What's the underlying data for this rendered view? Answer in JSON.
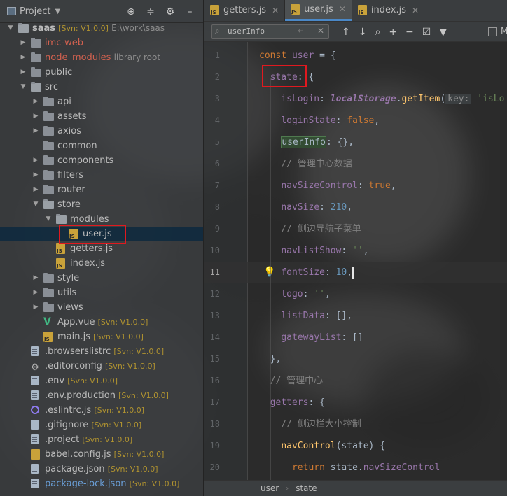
{
  "project": {
    "title": "Project",
    "tree": [
      {
        "label": "saas",
        "svn": "[Svn: V1.0.0]",
        "path": "E:\\work\\saas",
        "indent": 0,
        "kind": "folder-open",
        "arrow": "down",
        "style": "normal"
      },
      {
        "label": "imc-web",
        "indent": 1,
        "kind": "folder",
        "arrow": "right",
        "style": "red"
      },
      {
        "label": "node_modules",
        "lib": "library root",
        "indent": 1,
        "kind": "folder",
        "arrow": "right",
        "style": "red"
      },
      {
        "label": "public",
        "indent": 1,
        "kind": "folder",
        "arrow": "right",
        "style": "normal"
      },
      {
        "label": "src",
        "indent": 1,
        "kind": "folder-open",
        "arrow": "down",
        "style": "normal"
      },
      {
        "label": "api",
        "indent": 2,
        "kind": "folder",
        "arrow": "right",
        "style": "normal"
      },
      {
        "label": "assets",
        "indent": 2,
        "kind": "folder",
        "arrow": "right",
        "style": "normal"
      },
      {
        "label": "axios",
        "indent": 2,
        "kind": "folder",
        "arrow": "right",
        "style": "normal"
      },
      {
        "label": "common",
        "indent": 2,
        "kind": "folder",
        "arrow": "none",
        "style": "normal"
      },
      {
        "label": "components",
        "indent": 2,
        "kind": "folder",
        "arrow": "right",
        "style": "normal"
      },
      {
        "label": "filters",
        "indent": 2,
        "kind": "folder",
        "arrow": "right",
        "style": "normal"
      },
      {
        "label": "router",
        "indent": 2,
        "kind": "folder",
        "arrow": "right",
        "style": "normal"
      },
      {
        "label": "store",
        "indent": 2,
        "kind": "folder-open",
        "arrow": "down",
        "style": "normal"
      },
      {
        "label": "modules",
        "indent": 3,
        "kind": "folder-open",
        "arrow": "down",
        "style": "normal"
      },
      {
        "label": "user.js",
        "indent": 4,
        "kind": "js",
        "arrow": "none",
        "style": "normal",
        "selected": true
      },
      {
        "label": "getters.js",
        "indent": 3,
        "kind": "js",
        "arrow": "none",
        "style": "normal"
      },
      {
        "label": "index.js",
        "indent": 3,
        "kind": "js",
        "arrow": "none",
        "style": "normal"
      },
      {
        "label": "style",
        "indent": 2,
        "kind": "folder",
        "arrow": "right",
        "style": "normal"
      },
      {
        "label": "utils",
        "indent": 2,
        "kind": "folder",
        "arrow": "right",
        "style": "normal"
      },
      {
        "label": "views",
        "indent": 2,
        "kind": "folder",
        "arrow": "right",
        "style": "normal"
      },
      {
        "label": "App.vue",
        "svn": "[Svn: V1.0.0]",
        "indent": 2,
        "kind": "vue",
        "arrow": "none",
        "style": "normal"
      },
      {
        "label": "main.js",
        "svn": "[Svn: V1.0.0]",
        "indent": 2,
        "kind": "js",
        "arrow": "none",
        "style": "normal"
      },
      {
        "label": ".browserslistrc",
        "svn": "[Svn: V1.0.0]",
        "indent": 1,
        "kind": "file",
        "arrow": "none",
        "style": "normal"
      },
      {
        "label": ".editorconfig",
        "svn": "[Svn: V1.0.0]",
        "indent": 1,
        "kind": "gear",
        "arrow": "none",
        "style": "normal"
      },
      {
        "label": ".env",
        "svn": "[Svn: V1.0.0]",
        "indent": 1,
        "kind": "file",
        "arrow": "none",
        "style": "normal"
      },
      {
        "label": ".env.production",
        "svn": "[Svn: V1.0.0]",
        "indent": 1,
        "kind": "file",
        "arrow": "none",
        "style": "normal"
      },
      {
        "label": ".eslintrc.js",
        "svn": "[Svn: V1.0.0]",
        "indent": 1,
        "kind": "eslint",
        "arrow": "none",
        "style": "normal"
      },
      {
        "label": ".gitignore",
        "svn": "[Svn: V1.0.0]",
        "indent": 1,
        "kind": "file",
        "arrow": "none",
        "style": "normal"
      },
      {
        "label": ".project",
        "svn": "[Svn: V1.0.0]",
        "indent": 1,
        "kind": "file",
        "arrow": "none",
        "style": "normal"
      },
      {
        "label": "babel.config.js",
        "svn": "[Svn: V1.0.0]",
        "indent": 1,
        "kind": "babel",
        "arrow": "none",
        "style": "normal"
      },
      {
        "label": "package.json",
        "svn": "[Svn: V1.0.0]",
        "indent": 1,
        "kind": "file",
        "arrow": "none",
        "style": "normal"
      },
      {
        "label": "package-lock.json",
        "svn": "[Svn: V1.0.0]",
        "indent": 1,
        "kind": "file",
        "arrow": "none",
        "style": "blue"
      }
    ]
  },
  "tabs": [
    {
      "label": "getters.js",
      "active": false
    },
    {
      "label": "user.js",
      "active": true
    },
    {
      "label": "index.js",
      "active": false
    }
  ],
  "search": {
    "value": "userInfo",
    "m_label": "M"
  },
  "editor": {
    "current_line": 11,
    "lines": [
      {
        "num": "1",
        "code": [
          [
            "k",
            "const "
          ],
          [
            "n",
            "user"
          ],
          [
            "def",
            " = {"
          ]
        ]
      },
      {
        "num": "2",
        "code": [
          [
            "def",
            "  "
          ],
          [
            "prop",
            "state"
          ],
          [
            "def",
            ": {"
          ]
        ],
        "indent": 1
      },
      {
        "num": "3",
        "code": [
          [
            "def",
            "    "
          ],
          [
            "prop",
            "isLogin"
          ],
          [
            "def",
            ": "
          ],
          [
            "v",
            "localStorage"
          ],
          [
            "def",
            "."
          ],
          [
            "fn",
            "getItem"
          ],
          [
            "def",
            "("
          ],
          [
            "hint",
            "key:"
          ],
          [
            "s",
            " 'isLo"
          ]
        ],
        "indent": 2
      },
      {
        "num": "4",
        "code": [
          [
            "def",
            "    "
          ],
          [
            "prop",
            "loginState"
          ],
          [
            "def",
            ": "
          ],
          [
            "k",
            "false"
          ],
          [
            "def",
            ","
          ]
        ],
        "indent": 2
      },
      {
        "num": "5",
        "code": [
          [
            "def",
            "    "
          ],
          [
            "uinfo",
            "userInfo"
          ],
          [
            "def",
            ": {},"
          ]
        ],
        "indent": 2
      },
      {
        "num": "6",
        "code": [
          [
            "def",
            "    "
          ],
          [
            "cmt",
            "// 管理中心数据"
          ]
        ],
        "indent": 2
      },
      {
        "num": "7",
        "code": [
          [
            "def",
            "    "
          ],
          [
            "prop",
            "navSizeControl"
          ],
          [
            "def",
            ": "
          ],
          [
            "k",
            "true"
          ],
          [
            "def",
            ","
          ]
        ],
        "indent": 2
      },
      {
        "num": "8",
        "code": [
          [
            "def",
            "    "
          ],
          [
            "prop",
            "navSize"
          ],
          [
            "def",
            ": "
          ],
          [
            "num-lit",
            "210"
          ],
          [
            "def",
            ","
          ]
        ],
        "indent": 2
      },
      {
        "num": "9",
        "code": [
          [
            "def",
            "    "
          ],
          [
            "cmt",
            "// 侧边导航子菜单"
          ]
        ],
        "indent": 2
      },
      {
        "num": "10",
        "code": [
          [
            "def",
            "    "
          ],
          [
            "prop",
            "navListShow"
          ],
          [
            "def",
            ": "
          ],
          [
            "s",
            "''"
          ],
          [
            "def",
            ","
          ]
        ],
        "indent": 2
      },
      {
        "num": "11",
        "code": [
          [
            "def",
            "    "
          ],
          [
            "prop",
            "fontSize"
          ],
          [
            "def",
            ": "
          ],
          [
            "num-lit",
            "10"
          ],
          [
            "def",
            ","
          ]
        ],
        "indent": 2
      },
      {
        "num": "12",
        "code": [
          [
            "def",
            "    "
          ],
          [
            "prop",
            "logo"
          ],
          [
            "def",
            ": "
          ],
          [
            "s",
            "''"
          ],
          [
            "def",
            ","
          ]
        ],
        "indent": 2
      },
      {
        "num": "13",
        "code": [
          [
            "def",
            "    "
          ],
          [
            "prop",
            "listData"
          ],
          [
            "def",
            ": [],"
          ]
        ],
        "indent": 2
      },
      {
        "num": "14",
        "code": [
          [
            "def",
            "    "
          ],
          [
            "prop",
            "gatewayList"
          ],
          [
            "def",
            ": []"
          ]
        ],
        "indent": 2
      },
      {
        "num": "15",
        "code": [
          [
            "def",
            "  },"
          ]
        ],
        "indent": 1
      },
      {
        "num": "16",
        "code": [
          [
            "def",
            "  "
          ],
          [
            "cmt",
            "// 管理中心"
          ]
        ],
        "indent": 1
      },
      {
        "num": "17",
        "code": [
          [
            "def",
            "  "
          ],
          [
            "prop",
            "getters"
          ],
          [
            "def",
            ": {"
          ]
        ],
        "indent": 1
      },
      {
        "num": "18",
        "code": [
          [
            "def",
            "    "
          ],
          [
            "cmt",
            "// 侧边栏大小控制"
          ]
        ],
        "indent": 2
      },
      {
        "num": "19",
        "code": [
          [
            "def",
            "    "
          ],
          [
            "fn",
            "navControl"
          ],
          [
            "def",
            "(state) {"
          ]
        ],
        "indent": 2
      },
      {
        "num": "20",
        "code": [
          [
            "def",
            "      "
          ],
          [
            "k",
            "return "
          ],
          [
            "def",
            "state."
          ],
          [
            "prop",
            "navSizeControl"
          ]
        ],
        "indent": 3
      }
    ]
  },
  "breadcrumb": [
    "user",
    "state"
  ],
  "icons": {
    "project": "project-icon",
    "target": "locate-icon",
    "collapse": "collapse-icon",
    "settings": "gear-icon",
    "hide": "hide-icon"
  },
  "colors": {
    "highlight": "#e0191f",
    "accent": "#4a88c7"
  }
}
